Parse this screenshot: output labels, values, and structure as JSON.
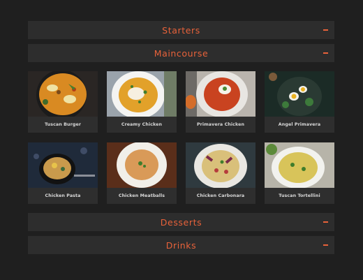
{
  "menu": {
    "sections": [
      {
        "label": "Starters",
        "toggle_icon": "minus-icon"
      },
      {
        "label": "Maincourse",
        "toggle_icon": "minus-icon"
      },
      {
        "label": "Desserts",
        "toggle_icon": "minus-icon"
      },
      {
        "label": "Drinks",
        "toggle_icon": "minus-icon"
      }
    ],
    "maincourse_items": [
      {
        "name": "Tuscan Burger"
      },
      {
        "name": "Creamy Chicken"
      },
      {
        "name": "Primavera Chicken"
      },
      {
        "name": "Angel Primavera"
      },
      {
        "name": "Chicken Pasta"
      },
      {
        "name": "Chicken Meatballs"
      },
      {
        "name": "Chicken Carbonara"
      },
      {
        "name": "Tuscan Tortellini"
      }
    ]
  },
  "colors": {
    "background": "#1f1f1f",
    "panel": "#2d2d2d",
    "accent": "#e8623a",
    "card_text": "#d9d9d9"
  }
}
